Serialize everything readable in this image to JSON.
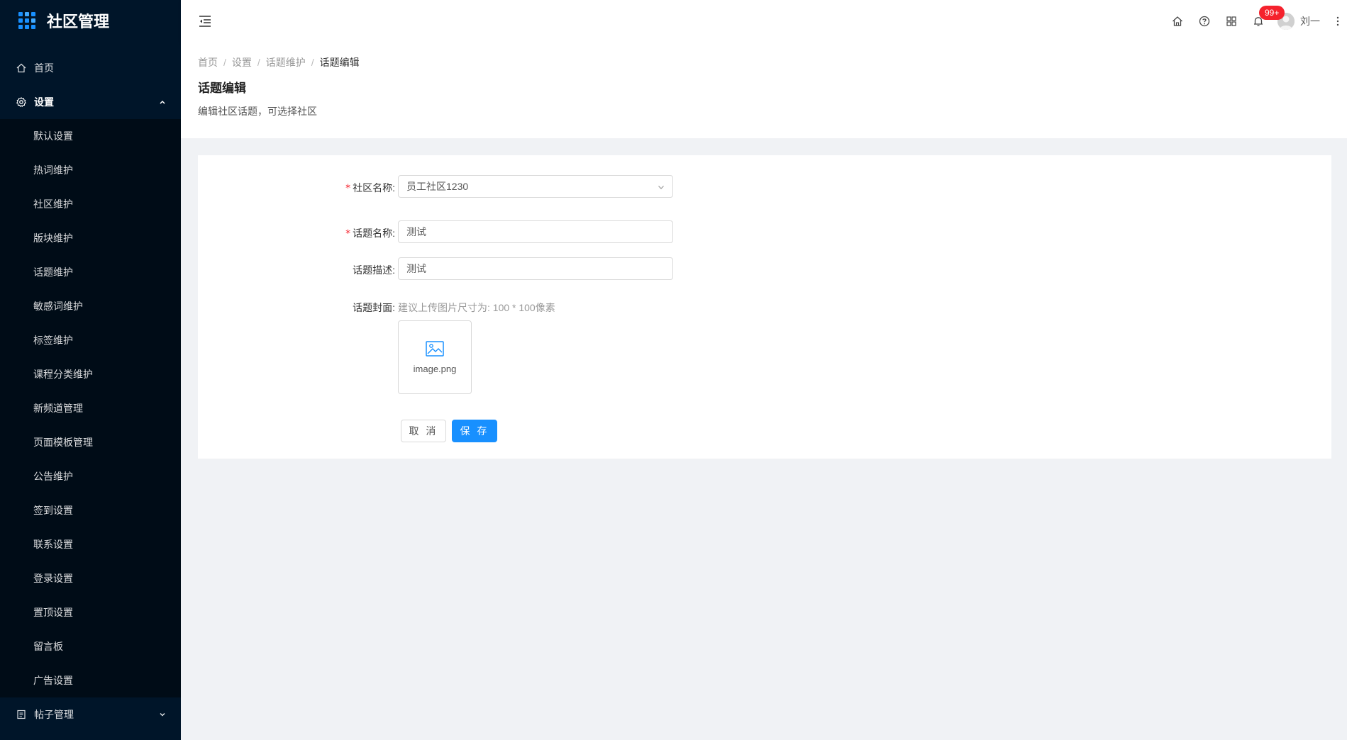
{
  "sidebar": {
    "app_title": "社区管理",
    "menu": [
      {
        "label": "首页"
      },
      {
        "label": "设置"
      }
    ],
    "sub_items": [
      {
        "label": "默认设置"
      },
      {
        "label": "热词维护"
      },
      {
        "label": "社区维护"
      },
      {
        "label": "版块维护"
      },
      {
        "label": "话题维护"
      },
      {
        "label": "敏感词维护"
      },
      {
        "label": "标签维护"
      },
      {
        "label": "课程分类维护"
      },
      {
        "label": "新频道管理"
      },
      {
        "label": "页面模板管理"
      },
      {
        "label": "公告维护"
      },
      {
        "label": "签到设置"
      },
      {
        "label": "联系设置"
      },
      {
        "label": "登录设置"
      },
      {
        "label": "置顶设置"
      },
      {
        "label": "留言板"
      },
      {
        "label": "广告设置"
      }
    ],
    "post_menu": {
      "label": "帖子管理"
    }
  },
  "header": {
    "notification_badge": "99+",
    "user_name": "刘一"
  },
  "page_header": {
    "breadcrumb": [
      "首页",
      "设置",
      "话题维护",
      "话题编辑"
    ],
    "title": "话题编辑",
    "description": "编辑社区话题，可选择社区"
  },
  "form": {
    "community": {
      "label": "社区名称:",
      "value": "员工社区1230",
      "required": true
    },
    "topic_name": {
      "label": "话题名称:",
      "value": "测试",
      "required": true
    },
    "topic_desc": {
      "label": "话题描述:",
      "value": "测试",
      "required": false
    },
    "cover": {
      "label": "话题封面:",
      "hint": "建议上传图片尺寸为: 100 * 100像素",
      "file_name": "image.png"
    },
    "cancel_label": "取 消",
    "save_label": "保 存"
  },
  "colors": {
    "sidebar_bg": "#001529",
    "primary": "#1890ff",
    "badge": "#f5222d"
  }
}
